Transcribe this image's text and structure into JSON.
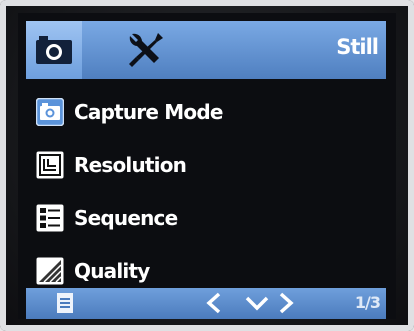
{
  "header": {
    "mode_label": "Still",
    "tabs": [
      {
        "icon": "camera-icon",
        "selected": true
      },
      {
        "icon": "wrench-screwdriver-icon",
        "selected": false
      }
    ]
  },
  "menu": {
    "items": [
      {
        "label": "Capture Mode",
        "icon": "capture-mode-icon",
        "highlighted": true
      },
      {
        "label": "Resolution",
        "icon": "resolution-icon",
        "highlighted": false
      },
      {
        "label": "Sequence",
        "icon": "sequence-icon",
        "highlighted": false
      },
      {
        "label": "Quality",
        "icon": "quality-icon",
        "highlighted": false
      }
    ]
  },
  "footer": {
    "page_indicator": "1/3"
  },
  "colors": {
    "accent_blue": "#5a8ad0",
    "selected_tab": "#9fc4f2",
    "screen_bg": "#0c0d11",
    "text": "#ffffff"
  }
}
